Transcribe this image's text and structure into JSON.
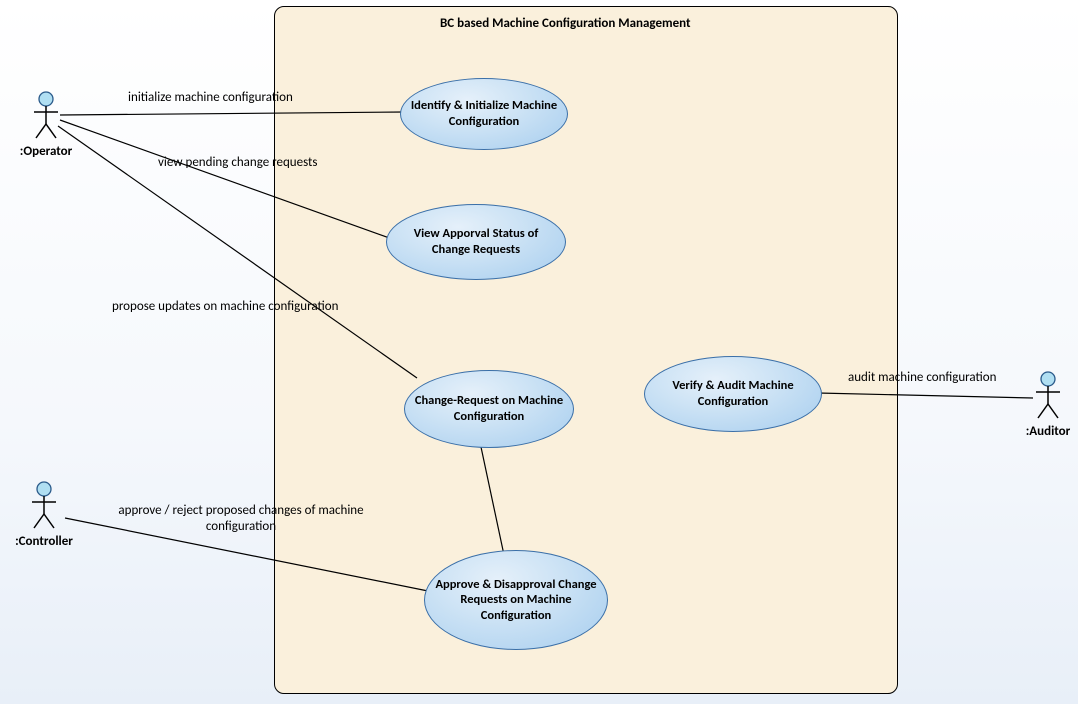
{
  "system": {
    "title": "BC based Machine Configuration Management"
  },
  "actors": {
    "operator": {
      "label": ":Operator"
    },
    "controller": {
      "label": ":Controller"
    },
    "auditor": {
      "label": ":Auditor"
    }
  },
  "usecases": {
    "identify": {
      "label": "Identify & Initialize Machine Configuration"
    },
    "viewstatus": {
      "label": "View Apporval Status of Change Requests"
    },
    "changereq": {
      "label": "Change-Request on Machine Configuration"
    },
    "approve": {
      "label": "Approve & Disapproval Change Requests on Machine Configuration"
    },
    "verify": {
      "label": "Verify & Audit Machine Configuration"
    }
  },
  "assoc": {
    "init": {
      "label": "initialize machine configuration"
    },
    "viewpending": {
      "label": "view pending change requests"
    },
    "propose": {
      "label": "propose updates on machine configuration"
    },
    "approve": {
      "label": "approve / reject proposed changes of machine configuration"
    },
    "audit": {
      "label": "audit machine configuration"
    }
  },
  "chart_data": {
    "type": "uml_use_case",
    "system_boundary": "BC based Machine Configuration Management",
    "actors": [
      "Operator",
      "Controller",
      "Auditor"
    ],
    "use_cases": [
      "Identify & Initialize Machine Configuration",
      "View Apporval Status of Change Requests",
      "Change-Request on Machine Configuration",
      "Approve & Disapproval Change Requests on Machine Configuration",
      "Verify & Audit Machine Configuration"
    ],
    "associations": [
      {
        "actor": "Operator",
        "usecase": "Identify & Initialize Machine Configuration",
        "label": "initialize machine configuration"
      },
      {
        "actor": "Operator",
        "usecase": "View Apporval Status of Change Requests",
        "label": "view pending change requests"
      },
      {
        "actor": "Operator",
        "usecase": "Change-Request on Machine Configuration",
        "label": "propose updates on machine configuration"
      },
      {
        "actor": "Controller",
        "usecase": "Approve & Disapproval Change Requests on Machine Configuration",
        "label": "approve / reject proposed changes of machine configuration"
      },
      {
        "actor": "Auditor",
        "usecase": "Verify & Audit Machine Configuration",
        "label": "audit machine configuration"
      }
    ],
    "internal_lines": [
      {
        "from": "Change-Request on Machine Configuration",
        "to": "Approve & Disapproval Change Requests on Machine Configuration"
      }
    ]
  }
}
